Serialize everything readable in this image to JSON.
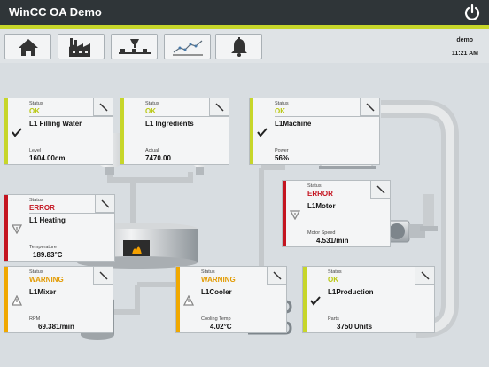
{
  "app": {
    "title": "WinCC OA Demo"
  },
  "header": {
    "user": "demo",
    "time": "11:21 AM"
  },
  "toolbar": {
    "buttons": [
      "home-icon",
      "factory-icon",
      "conveyor-icon",
      "trend-chart-icon",
      "alarm-bell-icon"
    ]
  },
  "colors": {
    "titlebar": "#2f3538",
    "accent": "#c7d62a",
    "ok": "#c7d62a",
    "error": "#c41420",
    "warning": "#f0a800"
  },
  "cards": [
    {
      "id": "l1-filling-water",
      "state": "ok",
      "status_label": "Status",
      "status": "OK",
      "name": "L1 Filling Water",
      "metric_label": "Level",
      "metric_value": "1604.00cm",
      "icon": "check-icon"
    },
    {
      "id": "l1-ingredients",
      "state": "ok",
      "status_label": "Status",
      "status": "OK",
      "name": "L1 Ingredients",
      "metric_label": "Actual",
      "metric_value": "7470.00",
      "icon": ""
    },
    {
      "id": "l1-machine",
      "state": "ok",
      "status_label": "Status",
      "status": "OK",
      "name": "L1Machine",
      "metric_label": "Power",
      "metric_value": "56%",
      "icon": "check-icon"
    },
    {
      "id": "l1-motor",
      "state": "error",
      "status_label": "Status",
      "status": "ERROR",
      "name": "L1Motor",
      "metric_label": "Motor Speed",
      "metric_value": "4.531/min",
      "icon": "error-triangle-icon"
    },
    {
      "id": "l1-heating",
      "state": "error",
      "status_label": "Status",
      "status": "ERROR",
      "name": "L1 Heating",
      "metric_label": "Temperature",
      "metric_value": "189.83°C",
      "icon": "error-triangle-icon"
    },
    {
      "id": "l1-mixer",
      "state": "warning",
      "status_label": "Status",
      "status": "WARNING",
      "name": "L1Mixer",
      "metric_label": "RPM",
      "metric_value": "69.381/min",
      "icon": "warning-triangle-icon"
    },
    {
      "id": "l1-cooler",
      "state": "warning",
      "status_label": "Status",
      "status": "WARNING",
      "name": "L1Cooler",
      "metric_label": "Cooling Temp",
      "metric_value": "4.02°C",
      "icon": "warning-triangle-icon"
    },
    {
      "id": "l1-production",
      "state": "ok",
      "status_label": "Status",
      "status": "OK",
      "name": "L1Production",
      "metric_label": "Parts",
      "metric_value": "3750 Units",
      "icon": "check-icon"
    }
  ]
}
